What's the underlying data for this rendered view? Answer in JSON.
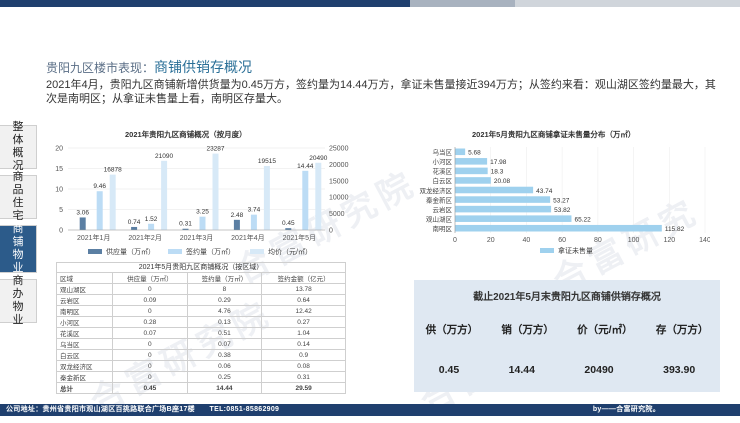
{
  "header": {
    "title_prefix": "贵阳九区楼市表现：",
    "title_main": "商铺供销存概况"
  },
  "intro": "2021年4月，贵阳九区商铺新增供货量为0.45万方，签约量为14.44万方，拿证未售量接近394万方；从签约来看：观山湖区签约量最大，其次是南明区；从拿证未售量上看，南明区存量大。",
  "sidenav": [
    {
      "label": "整体概况"
    },
    {
      "label": "商品住宅"
    },
    {
      "label": "商铺物业",
      "active": true
    },
    {
      "label": "商办物业"
    }
  ],
  "chart_data": [
    {
      "type": "bar",
      "title": "2021年贵阳九区商铺概况（按月度）",
      "categories": [
        "2021年1月",
        "2021年2月",
        "2021年3月",
        "2021年4月",
        "2021年5月"
      ],
      "series": [
        {
          "name": "供应量（万㎡）",
          "values": [
            3.06,
            0.74,
            0.31,
            2.48,
            0.45
          ]
        },
        {
          "name": "签约量（万㎡）",
          "values": [
            9.46,
            1.52,
            3.25,
            3.74,
            14.44
          ]
        },
        {
          "name": "均价（元/㎡）",
          "type": "line",
          "values": [
            16878,
            21090,
            23287,
            19515,
            20490
          ]
        }
      ],
      "ylim_left": [
        0,
        20
      ],
      "ylim_right": [
        0,
        25000
      ],
      "yticks_left": [
        "0",
        "5",
        "10",
        "15",
        "20"
      ],
      "yticks_right": [
        "0",
        "5000",
        "10000",
        "15000",
        "20000",
        "25000"
      ],
      "legend_position": "bottom",
      "colors": [
        "#5b7fa3",
        "#bcdcf5",
        "#d7e9f7"
      ]
    },
    {
      "type": "bar",
      "orientation": "horizontal",
      "title": "2021年5月贵阳九区商铺拿证未售量分布（万㎡）",
      "categories": [
        "乌当区",
        "小河区",
        "花溪区",
        "白云区",
        "观山湖区",
        "双龙经济区",
        "云岩区",
        "南明区"
      ],
      "series": [
        {
          "name": "拿证未售量",
          "values": [
            5.68,
            17.98,
            18.3,
            20.08,
            115.82,
            43.74,
            53.27,
            65.22,
            53.82
          ]
        }
      ],
      "bar_labels": [
        {
          "category": "乌当区",
          "value": 5.68
        },
        {
          "category": "小河区",
          "value": 17.98
        },
        {
          "category": "花溪区",
          "value": 18.3
        },
        {
          "category": "白云区",
          "value": 20.08
        },
        {
          "category": "双龙经济区",
          "value": 43.74
        },
        {
          "category": "秦金新区",
          "value": 53.27
        },
        {
          "category": "云岩区",
          "value": 53.82
        },
        {
          "category": "观山湖区",
          "value": 65.22
        },
        {
          "category": "南明区",
          "value": 115.82
        }
      ],
      "xlim": [
        0,
        140
      ],
      "xticks": [
        "0",
        "20",
        "40",
        "60",
        "80",
        "100",
        "120",
        "140"
      ],
      "legend_position": "bottom",
      "colors": [
        "#9fd1ee"
      ]
    }
  ],
  "table": {
    "caption": "2021年5月贵阳九区商铺概况（按区域）",
    "headers": [
      "区域",
      "供应量（万㎡）",
      "签约量（万㎡）",
      "签约金额（亿元）"
    ],
    "rows": [
      [
        "观山湖区",
        "0",
        "8",
        "13.78"
      ],
      [
        "云岩区",
        "0.09",
        "0.29",
        "0.64"
      ],
      [
        "南明区",
        "0",
        "4.76",
        "12.42"
      ],
      [
        "小河区",
        "0.28",
        "0.13",
        "0.27"
      ],
      [
        "花溪区",
        "0.07",
        "0.51",
        "1.04"
      ],
      [
        "乌当区",
        "0",
        "0.07",
        "0.14"
      ],
      [
        "白云区",
        "0",
        "0.38",
        "0.9"
      ],
      [
        "双龙经济区",
        "0",
        "0.06",
        "0.08"
      ],
      [
        "秦金新区",
        "0",
        "0.25",
        "0.31"
      ],
      [
        "总计",
        "0.45",
        "14.44",
        "29.59"
      ]
    ]
  },
  "summary": {
    "title": "截止2021年5月末贵阳九区商铺供销存概况",
    "headers": [
      "供（万方）",
      "销（万方）",
      "价（元/㎡）",
      "存（万方）"
    ],
    "values": [
      "0.45",
      "14.44",
      "20490",
      "393.90"
    ]
  },
  "footer": {
    "address": "公司地址：贵州省贵阳市观山湖区百挑路联合广场B座17楼　　TEL:0851-85862909",
    "credit": "by——合富研究院。"
  },
  "watermark": "合富研究院"
}
